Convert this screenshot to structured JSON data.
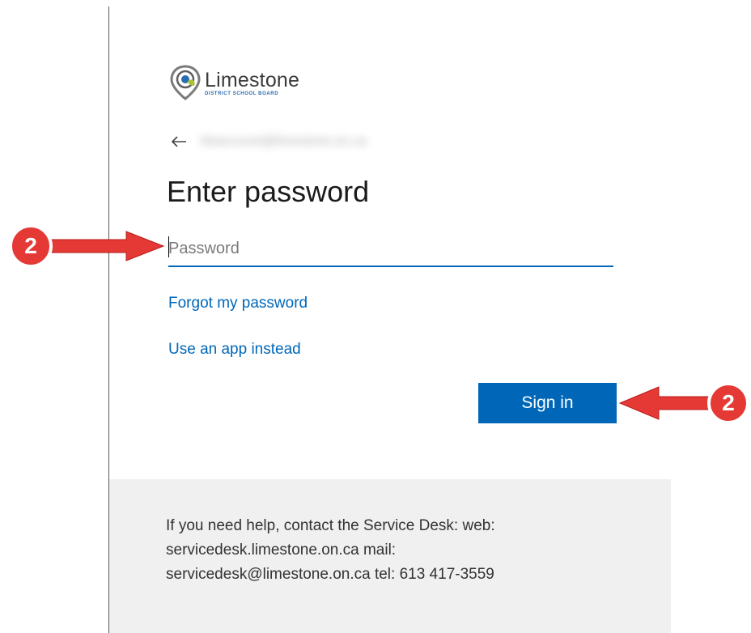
{
  "logo": {
    "name": "Limestone",
    "subtitle": "DISTRICT SCHOOL BOARD",
    "colors": {
      "outer": "#7a7a7a",
      "inner": "#2a6bb3",
      "leaf": "#a8c23a"
    }
  },
  "signin": {
    "identity": "ldsaccount@limestone.on.ca",
    "title": "Enter password",
    "password_placeholder": "Password",
    "forgot_link": "Forgot my password",
    "app_link": "Use an app instead",
    "signin_button": "Sign in"
  },
  "footer": {
    "help_text": "If you need help, contact the Service Desk: web: servicedesk.limestone.on.ca mail: servicedesk@limestone.on.ca tel: 613 417-3559"
  },
  "annotations": {
    "left_marker": "2",
    "right_marker": "2",
    "marker_color": "#e53935",
    "arrow_color": "#e53935"
  },
  "colors": {
    "accent": "#0067b8",
    "footer_bg": "#f0f0f0"
  },
  "icons": {
    "back": "back-arrow-icon",
    "logo": "limestone-logo-icon"
  }
}
